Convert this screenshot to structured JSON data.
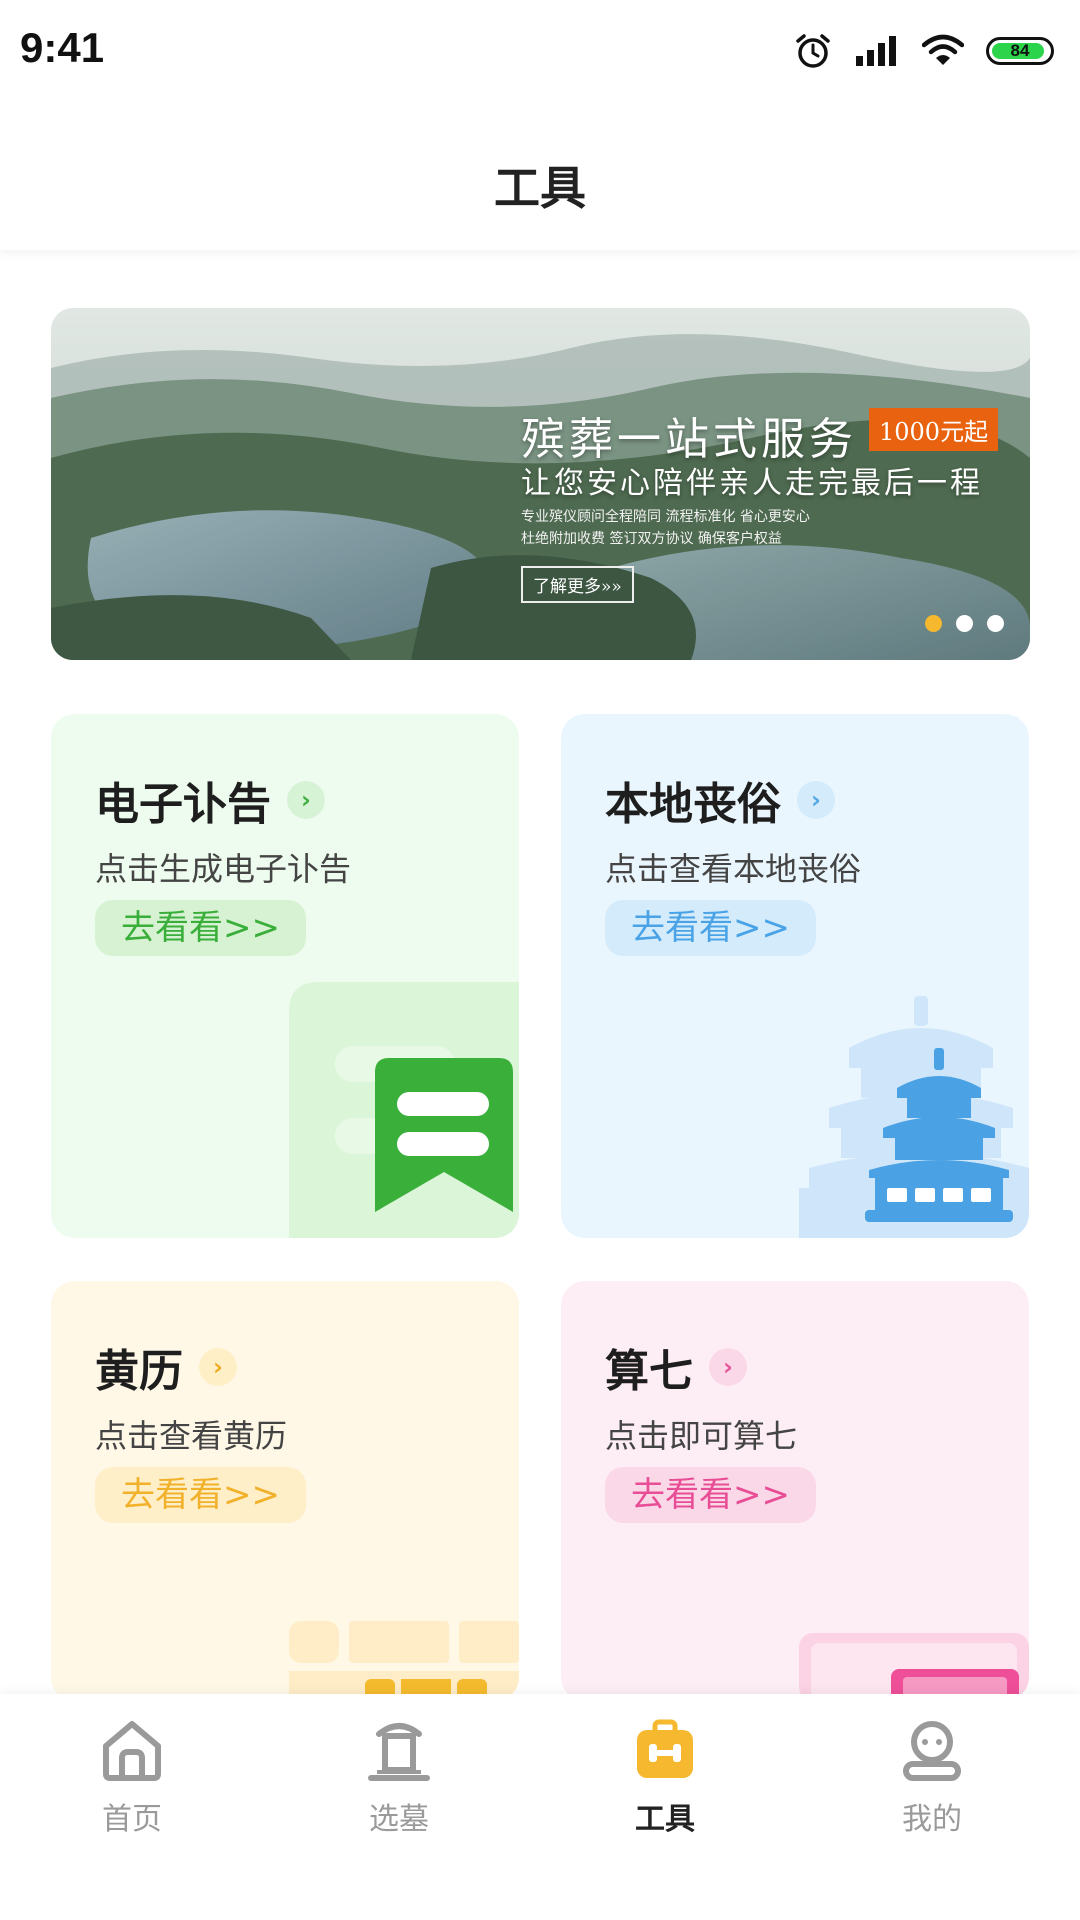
{
  "status_bar": {
    "time": "9:41",
    "battery_level": "84",
    "icons": [
      "alarm-icon",
      "signal-icon",
      "wifi-icon",
      "battery-icon"
    ]
  },
  "header": {
    "title": "工具"
  },
  "banner": {
    "title": "殡葬一站式服务",
    "price_tag": "1000元起",
    "subtitle": "让您安心陪伴亲人走完最后一程",
    "line1": "专业殡仪顾问全程陪同 流程标准化 省心更安心",
    "line2": "杜绝附加收费 签订双方协议 确保客户权益",
    "more_label": "了解更多»»",
    "slide_count": 3,
    "active_slide": 1
  },
  "cards": [
    {
      "title": "电子讣告",
      "desc": "点击生成电子讣告",
      "button": "去看看>>",
      "accent": "#3aae3a",
      "icon": "bookmark-icon"
    },
    {
      "title": "本地丧俗",
      "desc": "点击查看本地丧俗",
      "button": "去看看>>",
      "accent": "#49a3e6",
      "icon": "temple-icon"
    },
    {
      "title": "黄历",
      "desc": "点击查看黄历",
      "button": "去看看>>",
      "accent": "#f2b12a",
      "icon": "calendar-icon"
    },
    {
      "title": "算七",
      "desc": "点击即可算七",
      "button": "去看看>>",
      "accent": "#e84e96",
      "icon": "calculator-icon"
    }
  ],
  "tab_bar": {
    "items": [
      {
        "label": "首页",
        "icon": "home-icon"
      },
      {
        "label": "选墓",
        "icon": "tomb-icon"
      },
      {
        "label": "工具",
        "icon": "toolbox-icon"
      },
      {
        "label": "我的",
        "icon": "user-icon"
      }
    ],
    "active": "工具",
    "active_color": "#f5b82e"
  }
}
